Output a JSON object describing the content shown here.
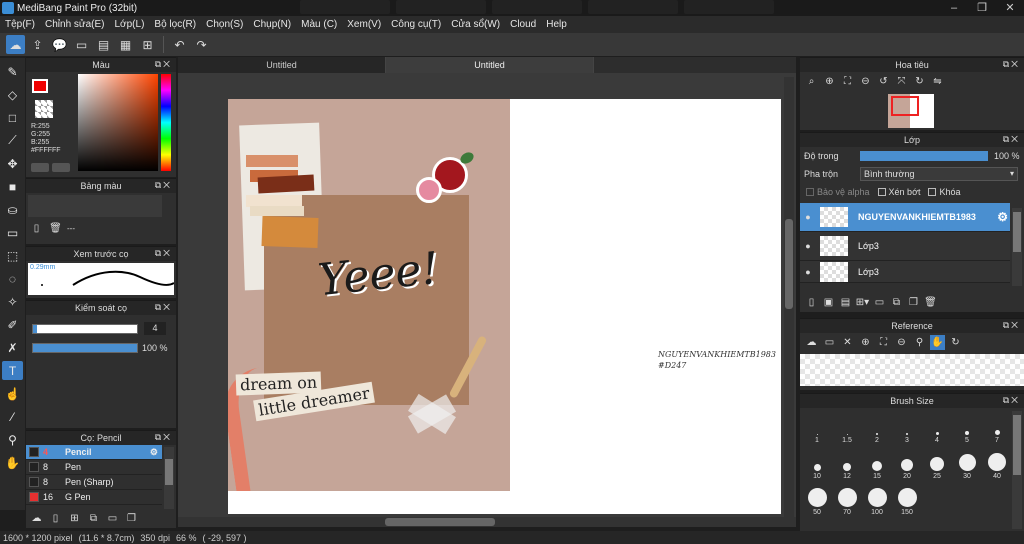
{
  "titlebar": {
    "title": "MediBang Paint Pro (32bit)"
  },
  "menu": [
    "Tệp(F)",
    "Chỉnh sửa(E)",
    "Lớp(L)",
    "Bộ lọc(R)",
    "Chọn(S)",
    "Chụp(N)",
    "Màu (C)",
    "Xem(V)",
    "Công cụ(T)",
    "Cửa sổ(W)",
    "Cloud",
    "Help"
  ],
  "color_panel": {
    "title": "Màu",
    "r": "R:255",
    "g": "G:255",
    "b": "B:255",
    "hex": "#FFFFFF",
    "primary_color": "#ff0000",
    "secondary_color": "#ffffff"
  },
  "palette_panel": {
    "title": "Bảng màu",
    "value": "---"
  },
  "brush_preview": {
    "title": "Xem trước cọ",
    "size": "0.29mm"
  },
  "brush_control": {
    "title": "Kiểm soát cọ",
    "size_value": "4",
    "opacity_value": "100 %"
  },
  "brush_list": {
    "title": "Cọ: Pencil",
    "items": [
      {
        "size": "4",
        "name": "Pencil",
        "color": "#222222"
      },
      {
        "size": "8",
        "name": "Pen",
        "color": "#222222"
      },
      {
        "size": "8",
        "name": "Pen (Sharp)",
        "color": "#222222"
      },
      {
        "size": "16",
        "name": "G Pen",
        "color": "#e53030"
      }
    ]
  },
  "tabs": [
    "Untitled",
    "Untitled"
  ],
  "canvas": {
    "artwork_title": "Yeee!",
    "stickers": [
      "dream on",
      "little dreamer"
    ],
    "signature_line1": "NGUYENVANKHIEMTB1983",
    "signature_line2": "#D247"
  },
  "navigator": {
    "title": "Hoa tiêu"
  },
  "layers": {
    "title": "Lớp",
    "opacity_label": "Độ trong",
    "opacity_value": "100 %",
    "blend_label": "Pha trộn",
    "blend_value": "Bình thường",
    "protect_alpha": "Bảo vệ alpha",
    "clipping": "Xén bớt",
    "lock": "Khóa",
    "items": [
      "NGUYENVANKHIEMTB1983",
      "Lớp3",
      "Lớp3"
    ]
  },
  "reference": {
    "title": "Reference"
  },
  "brush_size": {
    "title": "Brush Size",
    "sizes": [
      "1",
      "1.5",
      "2",
      "3",
      "4",
      "5",
      "7",
      "10",
      "12",
      "15",
      "20",
      "25",
      "30",
      "40",
      "50",
      "70",
      "100",
      "150"
    ]
  },
  "status": {
    "pixels": "1600 * 1200 pixel",
    "cm": "(11.6 * 8.7cm)",
    "dpi": "350 dpi",
    "zoom": "66 %",
    "coords": "( -29, 597 )"
  }
}
